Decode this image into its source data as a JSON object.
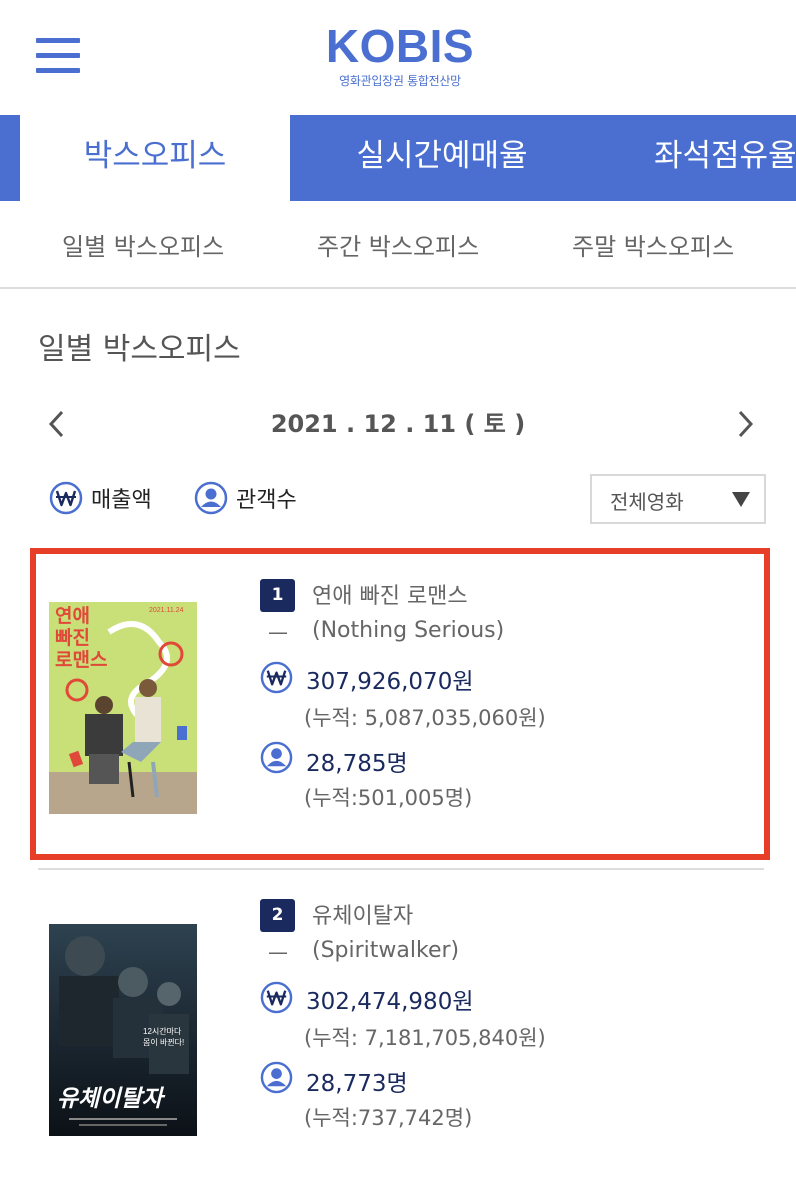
{
  "header": {
    "logo": "KOBIS",
    "logo_subtitle": "영화관입장권 통합전산망"
  },
  "main_tabs": [
    {
      "label": "박스오피스",
      "active": true
    },
    {
      "label": "실시간예매율",
      "active": false
    },
    {
      "label": "좌석점유율",
      "active": false
    }
  ],
  "sub_tabs": [
    {
      "label": "일별 박스오피스"
    },
    {
      "label": "주간 박스오피스"
    },
    {
      "label": "주말 박스오피스"
    }
  ],
  "section_title": "일별 박스오피스",
  "date": "2021 . 12 . 11 ( 토 )",
  "filters": {
    "sales_label": "매출액",
    "audience_label": "관객수",
    "select_value": "전체영화"
  },
  "movies": [
    {
      "rank": "1",
      "title_ko": "연애 빠진 로맨스",
      "dash": "—",
      "title_en": "(Nothing Serious)",
      "sales": "307,926,070원",
      "sales_cum": "(누적: 5,087,035,060원)",
      "audience": "28,785명",
      "audience_cum": "(누적:501,005명)",
      "poster_text": "연애\n빠진\n로맨스",
      "poster_date": "2021.11.24"
    },
    {
      "rank": "2",
      "title_ko": "유체이탈자",
      "dash": "—",
      "title_en": "(Spiritwalker)",
      "sales": "302,474,980원",
      "sales_cum": "(누적: 7,181,705,840원)",
      "audience": "28,773명",
      "audience_cum": "(누적:737,742명)",
      "poster_text": "유체이탈자",
      "poster_tagline": "12시간마다\n몸이 바뀐다!"
    }
  ],
  "colors": {
    "brand": "#4a6fd0",
    "navy": "#1a2a5e",
    "highlight": "#e63e29"
  },
  "icons": {
    "menu": "hamburger-icon",
    "sales": "won-icon",
    "audience": "person-icon",
    "prev": "chevron-left-icon",
    "next": "chevron-right-icon",
    "dropdown": "triangle-down-icon"
  }
}
